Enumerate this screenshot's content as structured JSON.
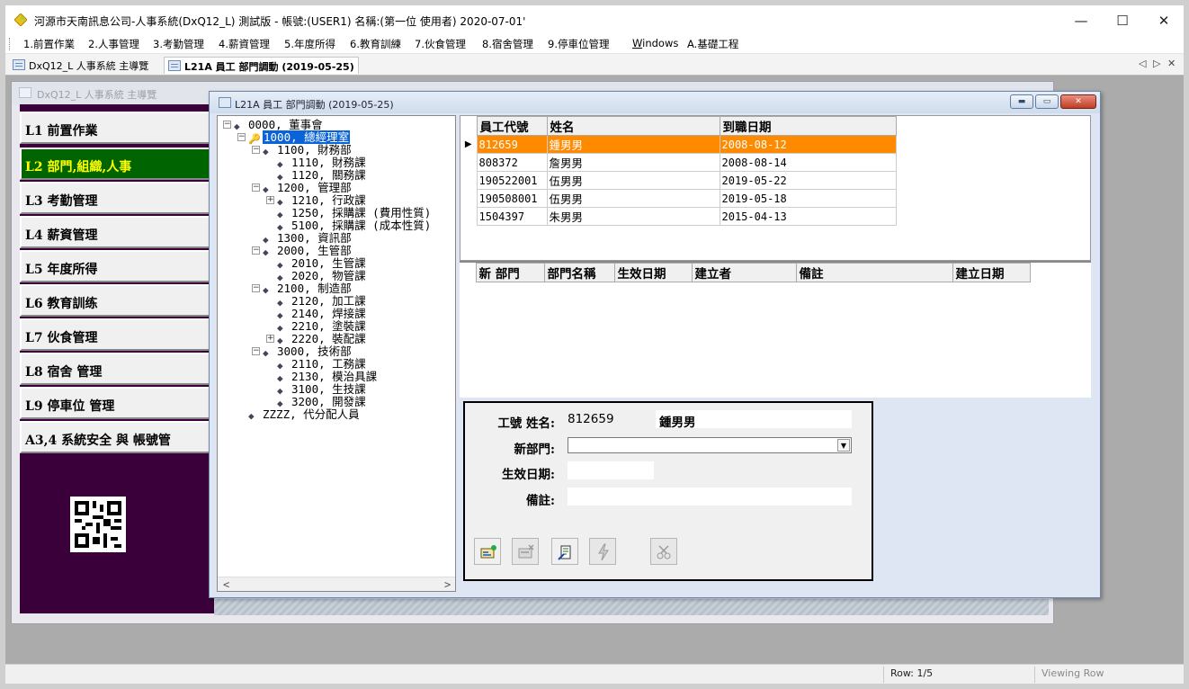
{
  "window": {
    "title": "河源市天南訊息公司-人事系統(DxQ12_L) 測試版 - 帳號:(USER1) 名稱:(第一位 使用者) 2020-07-01'",
    "minimize": "—",
    "maximize": "☐",
    "close": "✕"
  },
  "menu": [
    "1.前置作業",
    "2.人事管理",
    "3.考勤管理",
    "4.薪資管理",
    "5.年度所得",
    "6.教育訓練",
    "7.伙食管理",
    "8.宿舍管理",
    "9.停車位管理",
    "Windows",
    "A.基礎工程"
  ],
  "tabs": [
    {
      "label": "DxQ12_L 人事系統 主導覽",
      "active": false
    },
    {
      "label": "L21A 員工 部門調動 (2019-05-25)",
      "active": true
    }
  ],
  "tab_nav": {
    "left": "◁",
    "right": "▷",
    "close": "✕"
  },
  "nav_window": {
    "title": "DxQ12_L 人事系統 主導覽",
    "buttons": [
      "L1 前置作業",
      "L2 部門,組織,人事",
      "L3 考勤管理",
      "L4 薪資管理",
      "L5 年度所得",
      "L6 教育訓练",
      "L7 伙食管理",
      "L8 宿舍 管理",
      "L9 停車位 管理",
      "A3,4 系統安全 與 帳號管"
    ],
    "active_index": 1
  },
  "child_window": {
    "title": "L21A 員工 部門調動 (2019-05-25)"
  },
  "tree": [
    {
      "label": "0000, 董事會",
      "level": 0,
      "expander": "-",
      "selected": false
    },
    {
      "label": "1000, 總經理室",
      "level": 1,
      "expander": "-",
      "selected": true
    },
    {
      "label": "1100, 財務部",
      "level": 2,
      "expander": "-",
      "selected": false
    },
    {
      "label": "1110, 財務課",
      "level": 3,
      "expander": "",
      "selected": false
    },
    {
      "label": "1120, 關務課",
      "level": 3,
      "expander": "",
      "selected": false
    },
    {
      "label": "1200, 管理部",
      "level": 2,
      "expander": "-",
      "selected": false
    },
    {
      "label": "1210, 行政課",
      "level": 3,
      "expander": "+",
      "selected": false
    },
    {
      "label": "1250, 採購課 (費用性質)",
      "level": 3,
      "expander": "",
      "selected": false
    },
    {
      "label": "5100, 採購課 (成本性質)",
      "level": 3,
      "expander": "",
      "selected": false
    },
    {
      "label": "1300, 資訊部",
      "level": 2,
      "expander": "",
      "selected": false
    },
    {
      "label": "2000, 生管部",
      "level": 2,
      "expander": "-",
      "selected": false
    },
    {
      "label": "2010, 生管課",
      "level": 3,
      "expander": "",
      "selected": false
    },
    {
      "label": "2020, 物管課",
      "level": 3,
      "expander": "",
      "selected": false
    },
    {
      "label": "2100, 制造部",
      "level": 2,
      "expander": "-",
      "selected": false
    },
    {
      "label": "2120, 加工課",
      "level": 3,
      "expander": "",
      "selected": false
    },
    {
      "label": "2140, 焊接課",
      "level": 3,
      "expander": "",
      "selected": false
    },
    {
      "label": "2210, 塗裝課",
      "level": 3,
      "expander": "",
      "selected": false
    },
    {
      "label": "2220, 裝配課",
      "level": 3,
      "expander": "+",
      "selected": false
    },
    {
      "label": "3000, 技術部",
      "level": 2,
      "expander": "-",
      "selected": false
    },
    {
      "label": "2110, 工務課",
      "level": 3,
      "expander": "",
      "selected": false
    },
    {
      "label": "2130, 模治具課",
      "level": 3,
      "expander": "",
      "selected": false
    },
    {
      "label": "3100, 生技課",
      "level": 3,
      "expander": "",
      "selected": false
    },
    {
      "label": "3200, 開發課",
      "level": 3,
      "expander": "",
      "selected": false
    },
    {
      "label": "ZZZZ, 代分配人員",
      "level": 1,
      "expander": "",
      "selected": false
    }
  ],
  "tree_scroll": {
    "left": "<",
    "right": ">"
  },
  "employees": {
    "columns": [
      "員工代號",
      "姓名",
      "到職日期"
    ],
    "rows": [
      {
        "id": "812659",
        "name": "鍾男男",
        "date": "2008-08-12",
        "selected": true
      },
      {
        "id": "808372",
        "name": "詹男男",
        "date": "2008-08-14",
        "selected": false
      },
      {
        "id": "190522001",
        "name": "伍男男",
        "date": "2019-05-22",
        "selected": false
      },
      {
        "id": "190508001",
        "name": "伍男男",
        "date": "2019-05-18",
        "selected": false
      },
      {
        "id": "1504397",
        "name": "朱男男",
        "date": "2015-04-13",
        "selected": false
      }
    ],
    "indicator": "▶"
  },
  "history": {
    "columns": [
      "新 部門",
      "部門名稱",
      "生效日期",
      "建立者",
      "備註",
      "建立日期"
    ]
  },
  "form": {
    "emp_label": "工號 姓名:",
    "emp_id": "812659",
    "emp_name": "鍾男男",
    "new_dept_label": "新部門:",
    "new_dept_value": "",
    "effective_label": "生效日期:",
    "effective_value": "",
    "note_label": "備註:",
    "note_value": ""
  },
  "toolbar_icons": [
    "add-record-icon",
    "delete-record-icon",
    "edit-record-icon",
    "lightning-icon",
    "scissors-icon"
  ],
  "status": {
    "row": "Row: 1/5",
    "mode": "Viewing Row"
  },
  "colors": {
    "selected_row": "#ff8a00",
    "nav_active_bg": "#006400",
    "nav_active_fg": "#ffff00",
    "nav_panel": "#3a003a",
    "tree_selection": "#0a64d8"
  }
}
